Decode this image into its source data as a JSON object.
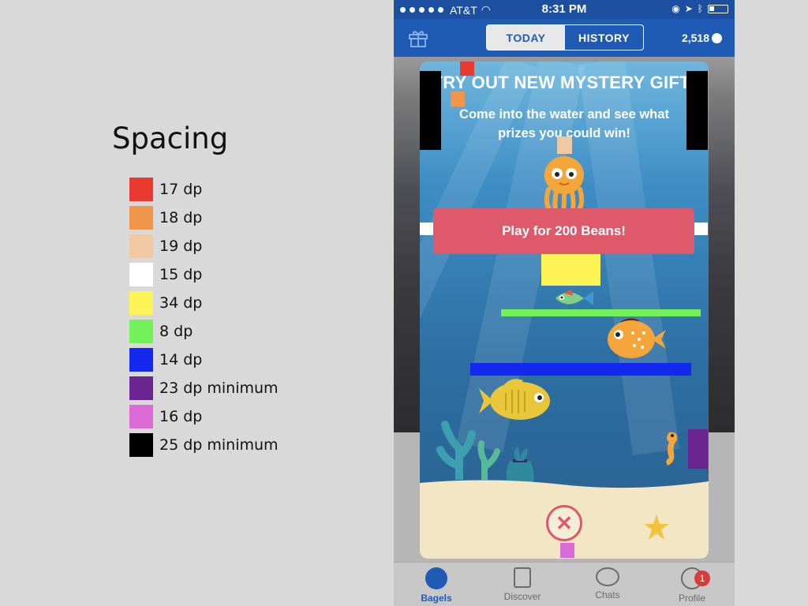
{
  "legend": {
    "title": "Spacing",
    "items": [
      {
        "color": "#e8392e",
        "label": "17 dp"
      },
      {
        "color": "#f0964a",
        "label": "18 dp"
      },
      {
        "color": "#f0c8a2",
        "label": "19 dp"
      },
      {
        "color": "#ffffff",
        "label": "15 dp"
      },
      {
        "color": "#fcf357",
        "label": "34 dp"
      },
      {
        "color": "#74f05a",
        "label": "8 dp"
      },
      {
        "color": "#1428f0",
        "label": "14 dp"
      },
      {
        "color": "#6c2490",
        "label": "23 dp minimum"
      },
      {
        "color": "#dc6ad6",
        "label": "16 dp"
      },
      {
        "color": "#000000",
        "label": "25 dp minimum"
      }
    ]
  },
  "status_bar": {
    "carrier": "AT&T",
    "time": "8:31 PM"
  },
  "header": {
    "tab_today": "TODAY",
    "tab_history": "HISTORY",
    "bean_count": "2,518"
  },
  "modal": {
    "title": "TRY OUT NEW MYSTERY GIFT!",
    "subtitle": "Come into the water and see what prizes you could win!",
    "play_button": "Play for 200 Beans!",
    "close_symbol": "✕"
  },
  "tabbar": {
    "bagels": "Bagels",
    "discover": "Discover",
    "chats": "Chats",
    "profile": "Profile",
    "profile_badge": "1"
  },
  "colors": {
    "header_blue": "#1f5bb5",
    "button_coral": "#de5a6a"
  }
}
